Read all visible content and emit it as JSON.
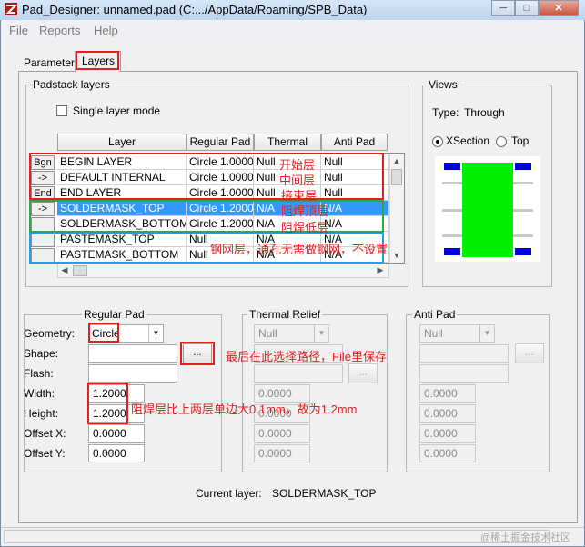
{
  "window": {
    "title": "Pad_Designer: unnamed.pad (C:.../AppData/Roaming/SPB_Data)",
    "controls": {
      "minimize": "─",
      "maximize": "□",
      "close": "✕"
    }
  },
  "menu": [
    "File",
    "Reports",
    "Help"
  ],
  "tabs": {
    "parameters": "Parameters",
    "layers": "Layers"
  },
  "padstack": {
    "group_title": "Padstack layers",
    "single_layer_mode": "Single layer mode",
    "columns": [
      "Layer",
      "Regular Pad",
      "Thermal Relief",
      "Anti Pad"
    ],
    "rows": [
      {
        "button": "Bgn",
        "layer": "BEGIN LAYER",
        "regular": "Circle 1.0000",
        "thermal": "Null",
        "anti": "Null"
      },
      {
        "button": "->",
        "layer": "DEFAULT INTERNAL",
        "regular": "Circle 1.0000",
        "thermal": "Null",
        "anti": "Null"
      },
      {
        "button": "End",
        "layer": "END LAYER",
        "regular": "Circle 1.0000",
        "thermal": "Null",
        "anti": "Null"
      },
      {
        "button": "->",
        "layer": "SOLDERMASK_TOP",
        "regular": "Circle 1.2000",
        "thermal": "N/A",
        "anti": "N/A"
      },
      {
        "button": "",
        "layer": "SOLDERMASK_BOTTOM",
        "regular": "Circle 1.2000",
        "thermal": "N/A",
        "anti": "N/A"
      },
      {
        "button": "",
        "layer": "PASTEMASK_TOP",
        "regular": "Null",
        "thermal": "N/A",
        "anti": "N/A"
      },
      {
        "button": "",
        "layer": "PASTEMASK_BOTTOM",
        "regular": "Null",
        "thermal": "N/A",
        "anti": "N/A"
      }
    ],
    "selected_row": 3
  },
  "views": {
    "group_title": "Views",
    "type_label": "Type:",
    "type_value": "Through",
    "xsection": "XSection",
    "top": "Top",
    "selected": "xsection"
  },
  "regular_pad": {
    "title": "Regular Pad",
    "geometry_label": "Geometry:",
    "geometry_value": "Circle",
    "shape_label": "Shape:",
    "browse": "...",
    "flash_label": "Flash:",
    "width_label": "Width:",
    "width_value": "1.2000",
    "height_label": "Height:",
    "height_value": "1.2000",
    "offset_x_label": "Offset X:",
    "offset_x_value": "0.0000",
    "offset_y_label": "Offset Y:",
    "offset_y_value": "0.0000"
  },
  "thermal_relief": {
    "title": "Thermal Relief",
    "geometry_value": "Null",
    "browse": "...",
    "width_value": "0.0000",
    "height_value": "0.0000",
    "offset_x_value": "0.0000",
    "offset_y_value": "0.0000"
  },
  "anti_pad": {
    "title": "Anti Pad",
    "geometry_value": "Null",
    "browse": "...",
    "width_value": "0.0000",
    "height_value": "0.0000",
    "offset_x_value": "0.0000",
    "offset_y_value": "0.0000"
  },
  "current_layer": {
    "label": "Current layer:",
    "value": "SOLDERMASK_TOP"
  },
  "annotations": {
    "start": "开始层",
    "middle": "中间层",
    "end": "接束层",
    "mask_top": "阻焊顶层",
    "mask_bottom": "阻焊低层",
    "paste": "钢网层，通孔无需做钢网，不设置",
    "path": "最后在此选择路径，File里保存",
    "size": "阻焊层比上两层单边大0.1mm，故为1.2mm"
  },
  "watermark": "@稀土掘金技术社区",
  "colors": {
    "annotation_red": "#e02020",
    "annotation_green": "#2aa84a",
    "annotation_blue": "#1ea3e0",
    "selection": "#3399ff",
    "pad_green": "#00ee00",
    "pad_blue": "#0000dd"
  }
}
